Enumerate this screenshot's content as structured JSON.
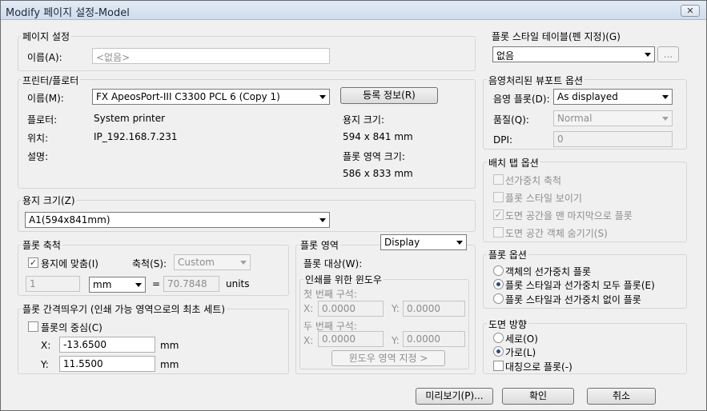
{
  "window": {
    "title": "Modify 페이지 설정-Model",
    "close_glyph": "✕"
  },
  "page_setup": {
    "group_label": "페이지 설정",
    "name_label": "이름(A):",
    "name_value": "<없음>"
  },
  "printer": {
    "group_label": "프린터/플로터",
    "name_label": "이름(M):",
    "name_value": "FX ApeosPort-III C3300 PCL 6 (Copy 1)",
    "properties_button": "등록 정보(R)",
    "plotter_label": "플로터:",
    "plotter_value": "System printer",
    "location_label": "위치:",
    "location_value": "IP_192.168.7.231",
    "description_label": "설명:",
    "paper_size_label": "용지 크기:",
    "paper_size_value": "594 x 841 mm",
    "plot_area_size_label": "플롯 영역 크기:",
    "plot_area_size_value": "586 x 833 mm"
  },
  "paper_size": {
    "group_label": "용지 크기(Z)",
    "value": "A1(594x841mm)"
  },
  "plot_scale": {
    "group_label": "플롯 축척",
    "fit_to_paper_label": "용지에 맞춤(I)",
    "fit_to_paper_checked": true,
    "check_glyph": "✓",
    "scale_label": "축척(S):",
    "scale_value": "Custom",
    "units_value": "1",
    "unit_select": "mm",
    "equals": "=",
    "drawing_units_value": "70.7848",
    "units_label": "units"
  },
  "plot_area": {
    "group_label": "플롯 영역",
    "what_to_plot_label": "플롯 대상(W):",
    "what_to_plot_value": "Display",
    "window_group_label": "인쇄를 위한 윈도우",
    "first_corner_label": "첫 번째 구석:",
    "second_corner_label": "두 번째 구석:",
    "x_label": "X:",
    "y_label": "Y:",
    "first_x": "0.0000",
    "first_y": "0.0000",
    "second_x": "0.0000",
    "second_y": "0.0000",
    "window_button": "윈도우 영역 지정 >"
  },
  "plot_offset": {
    "group_label": "플롯 간격띄우기 (인쇄 가능 영역으로의 최초 세트)",
    "center_label": "플롯의 중심(C)",
    "center_checked": false,
    "x_label": "X:",
    "x_value": "-13.6500",
    "y_label": "Y:",
    "y_value": "11.5500",
    "unit": "mm"
  },
  "plot_style_table": {
    "group_label": "플롯 스타일 테이블(펜 지정)(G)",
    "value": "없음",
    "edit_button": "..."
  },
  "shaded_viewport": {
    "group_label": "음영처리된 뷰포트 옵션",
    "shade_plot_label": "음영 플롯(D):",
    "shade_plot_value": "As displayed",
    "quality_label": "품질(Q):",
    "quality_value": "Normal",
    "dpi_label": "DPI:",
    "dpi_value": "0"
  },
  "layout_options": {
    "group_label": "배치 탭 옵션",
    "items": [
      {
        "label": "선가중치 축척",
        "checked": false
      },
      {
        "label": "플롯 스타일 보이기",
        "checked": false
      },
      {
        "label": "도면 공간을 맨 마지막으로 플롯",
        "checked": true
      },
      {
        "label": "도면 공간 객체 숨기기(S)",
        "checked": false
      }
    ]
  },
  "plot_options": {
    "group_label": "플롯 옵션",
    "items": [
      {
        "label": "객체의 선가중치 플롯",
        "selected": false
      },
      {
        "label": "플롯 스타일과 선가중치 모두 플롯(E)",
        "selected": true
      },
      {
        "label": "플롯 스타일과 선가중치 없이 플롯",
        "selected": false
      }
    ]
  },
  "drawing_orientation": {
    "group_label": "도면 방향",
    "portrait_label": "세로(O)",
    "landscape_label": "가로(L)",
    "selected": "landscape",
    "upside_down_label": "대칭으로 플롯(-)",
    "upside_down_checked": false
  },
  "footer": {
    "preview_button": "미리보기(P)...",
    "ok_button": "확인",
    "cancel_button": "취소"
  },
  "colors": {
    "title_bar": "#d6e2f0",
    "radio_dot": "#2a4a80",
    "dialog_bg": "#f0f0f0"
  }
}
